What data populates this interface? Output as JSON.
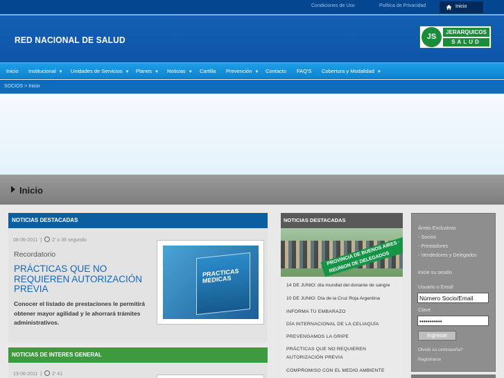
{
  "topbar": {
    "links": [
      "Condiciones de Uso",
      "Política de Privacidad"
    ],
    "home_label": "Inicio"
  },
  "header": {
    "brand": "RED NACIONAL DE SALUD",
    "logo_mark": "JS",
    "logo_line1": "JERARQUICOS",
    "logo_line2": "SALUD"
  },
  "nav": {
    "items": [
      {
        "label": "Inicio"
      },
      {
        "label": "Institucional",
        "dropdown": true
      },
      {
        "label": "Unidades de Servicios",
        "dropdown": true
      },
      {
        "label": "Planes",
        "dropdown": true
      },
      {
        "label": "Noticias",
        "dropdown": true
      },
      {
        "label": "Cartilla"
      },
      {
        "label": "Prevención",
        "dropdown": true
      },
      {
        "label": "Contacto"
      },
      {
        "label": "FAQ'S"
      },
      {
        "label": "Cobertura y Modalidad",
        "dropdown": true
      }
    ]
  },
  "breadcrumb": "SOCIOS > Inicio",
  "page_title": "Inicio",
  "featured": {
    "header": "NOTICIAS DESTACADAS",
    "date": "08-06-2011",
    "read_time": "2' o 36 segundo",
    "kicker": "Recordatorio",
    "headline": "PRÁCTICAS QUE NO REQUIEREN AUTORIZACIÓN PREVIA",
    "summary": "Conocer el listado de prestaciones le permitirá obtener mayor agilidad y le ahorrará trámites administrativos.",
    "thumb_text": "PRACTICAS MEDICAS"
  },
  "general": {
    "header": "NOTICIAS DE INTERES GENERAL",
    "date": "13-06-2011",
    "read_time": "2' 41"
  },
  "mid": {
    "header": "NOTICIAS DESTACADAS",
    "image_caption": "PROVINCIA DE BUENOS AIRES · REUNION DE DELEGADOS",
    "items": [
      "14 DE JUNIO: día mundial del donante de sangre",
      "10 DE JUNIO: Día de la Cruz Roja Argentina",
      "INFORMA TU EMBARAZO",
      "DÍA INTERNACIONAL DE LA CELIAQUÍA",
      "PREVENGAMOS LA GRIPE",
      "PRÁCTICAS QUE NO REQUIEREN AUTORIZACIÓN PREVIA",
      "COMPROMISO CON EL MEDIO AMBIENTE"
    ]
  },
  "login": {
    "areas_title": "Áreas Exclusivas",
    "areas": [
      "- Socios",
      "- Prestadores",
      "- Vendedores y Delegados"
    ],
    "session_title": "Inicie su sesión",
    "user_label": "Usuario o Email",
    "user_value": "Número Socio/Email",
    "pass_label": "Clave",
    "pass_value": "•••••••••••",
    "submit": "Ingresar",
    "forgot": "Olvidó su contraseña?",
    "register": "Registrarse"
  }
}
